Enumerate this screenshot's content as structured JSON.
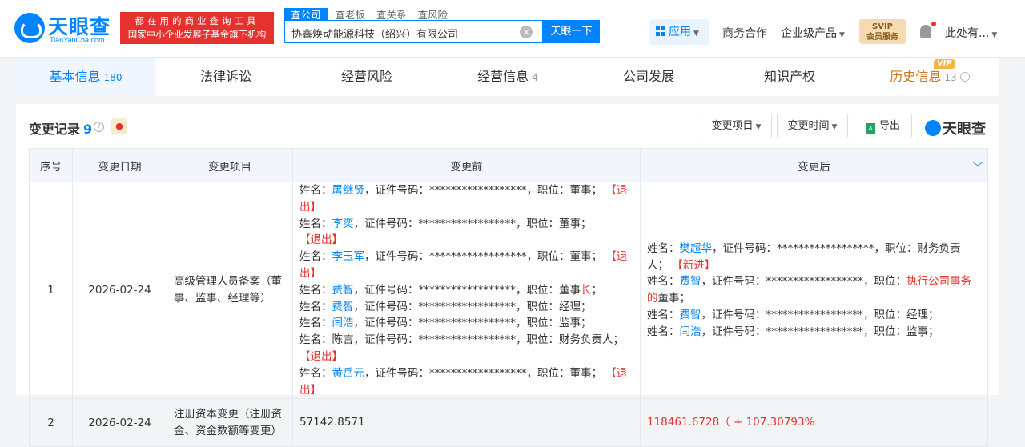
{
  "brand": {
    "name": "天眼查",
    "sub": "TianYanCha.com"
  },
  "slogan": {
    "line1": "都在用的商业查询工具",
    "line2": "国家中小企业发展子基金旗下机构"
  },
  "search": {
    "tabs": [
      "查公司",
      "查老板",
      "查关系",
      "查风险"
    ],
    "value": "协鑫焕动能源科技（绍兴）有限公司",
    "button": "天眼一下"
  },
  "header": {
    "app": "应用",
    "business": "商务合作",
    "enterprise": "企业级产品",
    "svip_line1": "SVIP",
    "svip_line2": "会员服务",
    "user": "此处有..."
  },
  "tabs": [
    {
      "label": "基本信息",
      "count": "180"
    },
    {
      "label": "法律诉讼",
      "count": ""
    },
    {
      "label": "经营风险",
      "count": ""
    },
    {
      "label": "经营信息",
      "count": "4"
    },
    {
      "label": "公司发展",
      "count": ""
    },
    {
      "label": "知识产权",
      "count": ""
    },
    {
      "label": "历史信息",
      "count": "13"
    }
  ],
  "vip_tag": "VIP",
  "section": {
    "title": "变更记录",
    "count": "9",
    "filter1": "变更项目",
    "filter2": "变更时间",
    "export": "导出",
    "brand": "天眼查"
  },
  "table": {
    "headers": [
      "序号",
      "变更日期",
      "变更项目",
      "变更前",
      "变更后"
    ],
    "rows": [
      {
        "no": "1",
        "date": "2026-02-24",
        "item": "高级管理人员备案（董事、监事、经理等）",
        "before": [
          {
            "pre": "姓名：",
            "name": "屠继贤",
            "mid": "，证件号码：******************，职位：董事；",
            "tag": "【退出】"
          },
          {
            "pre": "姓名：",
            "name": "李奕",
            "mid": "，证件号码：******************，职位：董事；",
            "tag": "【退出】"
          },
          {
            "pre": "姓名：",
            "name": "李玉军",
            "mid": "，证件号码：******************，职位：董事；",
            "tag": "【退出】"
          },
          {
            "pre": "姓名：",
            "name": "费智",
            "mid": "，证件号码：******************，职位：董事",
            "hl": "长",
            "end": "；"
          },
          {
            "pre": "姓名：",
            "name": "费智",
            "mid": "，证件号码：******************，职位：经理；"
          },
          {
            "pre": "姓名：",
            "name": "闫浩",
            "mid": "，证件号码：******************，职位：监事；"
          },
          {
            "pre": "姓名：",
            "plain": "陈言",
            "mid": "，证件号码：******************，职位：财务负责人；",
            "tag": "【退出】"
          },
          {
            "pre": "姓名：",
            "name": "黄岳元",
            "mid": "，证件号码：******************，职位：董事；",
            "tag": "【退出】"
          }
        ],
        "after": [
          {
            "pre": "姓名：",
            "name": "樊超华",
            "mid": "，证件号码：******************，职位：财务负责人；",
            "tag": "【新进】"
          },
          {
            "pre": "姓名：",
            "name": "费智",
            "mid": "，证件号码：******************，职位：",
            "hl": "执行公司事务的",
            "end": "董事；"
          },
          {
            "pre": "姓名：",
            "name": "费智",
            "mid": "，证件号码：******************，职位：经理；"
          },
          {
            "pre": "姓名：",
            "name": "闫浩",
            "mid": "，证件号码：******************，职位：监事；"
          }
        ]
      },
      {
        "no": "2",
        "date": "2026-02-24",
        "item": "注册资本变更（注册资金、资金数额等变更）",
        "before_text": "57142.8571",
        "after_text": "118461.6728（ + 107.30793%"
      }
    ]
  }
}
